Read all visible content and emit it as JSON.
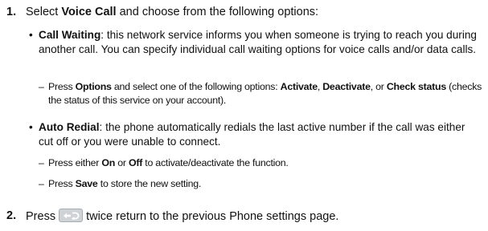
{
  "steps": [
    {
      "number": "1.",
      "prefix": "Select ",
      "bold": "Voice Call",
      "suffix": " and choose from the following options:"
    },
    {
      "number": "2.",
      "prefix": "Press",
      "suffix": "twice return to the previous Phone settings page."
    }
  ],
  "bullets": [
    {
      "term": "Call Waiting",
      "text": ": this network service informs you when someone is trying to reach you during another call. You can specify individual call waiting options for voice calls and/or data calls."
    },
    {
      "term": "Auto Redial",
      "text": ": the phone automatically redials the last active number if the call was either cut off or you were unable to connect."
    }
  ],
  "dash_items": {
    "options": {
      "a": "Press ",
      "b": "Options",
      "c": " and select one of the following options: ",
      "d": "Activate",
      "e": ", ",
      "f": "Deactivate",
      "g": ", or ",
      "h": "Check status",
      "i": " (checks the status of this service on your account)."
    },
    "on_off": {
      "a": "Press either ",
      "b": "On",
      "c": " or ",
      "d": "Off",
      "e": " to activate/deactivate the function."
    },
    "save": {
      "a": "Press ",
      "b": "Save",
      "c": " to store the new setting."
    }
  },
  "icons": {
    "back_key": "back-key-icon"
  },
  "colors": {
    "back_key_fill": "#cfd3d6",
    "back_key_glyph": "#ffffff"
  }
}
